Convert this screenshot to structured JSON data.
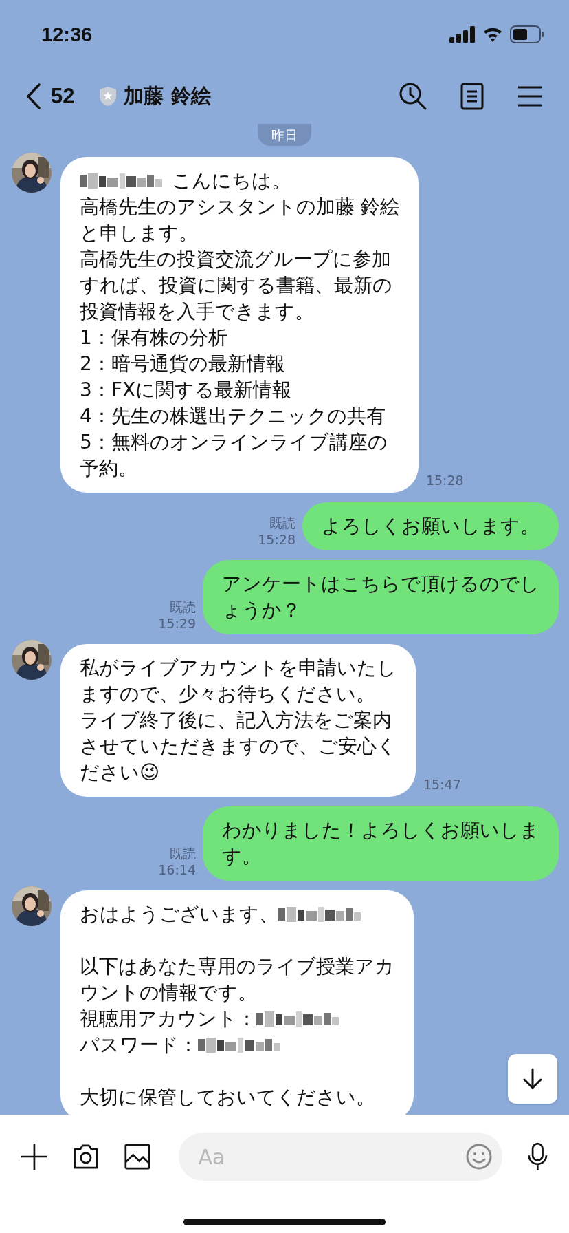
{
  "status_bar": {
    "time": "12:36"
  },
  "header": {
    "back_count": "52",
    "title": "加藤 鈴絵"
  },
  "date_divider": "昨日",
  "messages": [
    {
      "kind": "incoming",
      "time": "15:28",
      "lines": [
        {
          "kind": "maskfirst",
          "text": "こんにちは。"
        },
        {
          "kind": "text",
          "text": "高橋先生のアシスタントの加藤 鈴絵"
        },
        {
          "kind": "text",
          "text": "と申します。"
        },
        {
          "kind": "text",
          "text": "高橋先生の投資交流グループに参加"
        },
        {
          "kind": "text",
          "text": "すれば、投資に関する書籍、最新の"
        },
        {
          "kind": "text",
          "text": "投資情報を入手できます。"
        },
        {
          "kind": "text",
          "text": "1：保有株の分析"
        },
        {
          "kind": "text",
          "text": "2：暗号通貨の最新情報"
        },
        {
          "kind": "text",
          "text": "3：FXに関する最新情報"
        },
        {
          "kind": "text",
          "text": "4：先生の株選出テクニックの共有"
        },
        {
          "kind": "text",
          "text": "5：無料のオンラインライブ講座の"
        },
        {
          "kind": "text",
          "text": "予約。"
        }
      ]
    },
    {
      "kind": "outgoing",
      "read_label": "既読",
      "time": "15:28",
      "lines": [
        {
          "kind": "text",
          "text": "よろしくお願いします。"
        }
      ]
    },
    {
      "kind": "outgoing",
      "read_label": "既読",
      "time": "15:29",
      "lines": [
        {
          "kind": "text",
          "text": "アンケートはこちらで頂けるのでし"
        },
        {
          "kind": "text",
          "text": "ょうか？"
        }
      ]
    },
    {
      "kind": "incoming",
      "time": "15:47",
      "lines": [
        {
          "kind": "text",
          "text": "私がライブアカウントを申請いたし"
        },
        {
          "kind": "text",
          "text": "ますので、少々お待ちください。"
        },
        {
          "kind": "text",
          "text": "ライブ終了後に、記入方法をご案内"
        },
        {
          "kind": "text",
          "text": "させていただきますので、ご安心く"
        },
        {
          "kind": "text",
          "text": "ださい😉"
        }
      ]
    },
    {
      "kind": "outgoing",
      "read_label": "既読",
      "time": "16:14",
      "lines": [
        {
          "kind": "text",
          "text": "わかりました！よろしくお願いしま"
        },
        {
          "kind": "text",
          "text": "す。"
        }
      ]
    },
    {
      "kind": "incoming",
      "lines": [
        {
          "kind": "masklast",
          "text": "おはようございます、"
        },
        {
          "kind": "blank"
        },
        {
          "kind": "text",
          "text": "以下はあなた専用のライブ授業アカ"
        },
        {
          "kind": "text",
          "text": "ウントの情報です。"
        },
        {
          "kind": "masklast",
          "text": "視聴用アカウント："
        },
        {
          "kind": "masklast",
          "text": "パスワード："
        },
        {
          "kind": "blank"
        },
        {
          "kind": "text",
          "text": "大切に保管しておいてください。"
        }
      ]
    }
  ],
  "composer": {
    "placeholder": "Aa"
  }
}
